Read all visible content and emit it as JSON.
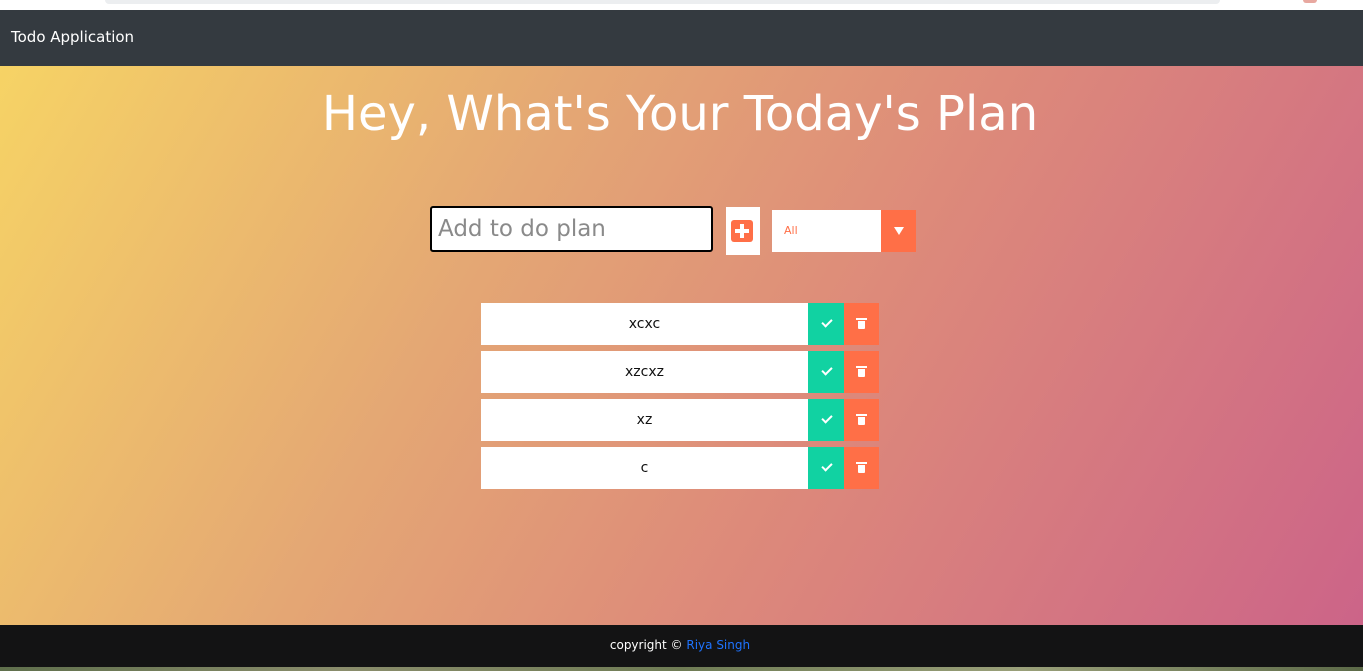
{
  "navbar": {
    "brand": "Todo Application"
  },
  "main": {
    "heading": "Hey, What's Your Today's Plan",
    "input": {
      "placeholder": "Add to do plan",
      "value": ""
    },
    "add_button_icon": "plus-square-icon",
    "filter": {
      "selected": "All",
      "icon": "caret-down-icon"
    }
  },
  "todos": [
    {
      "text": "xcxc"
    },
    {
      "text": "xzcxz"
    },
    {
      "text": "xz"
    },
    {
      "text": "c"
    }
  ],
  "footer": {
    "copyright": "copyright ©",
    "author": "Riya Singh"
  },
  "colors": {
    "accent": "#ff6f47",
    "complete": "#11d2a2",
    "navbar": "#343a40",
    "footer": "#131314",
    "link": "#1e73ff"
  }
}
